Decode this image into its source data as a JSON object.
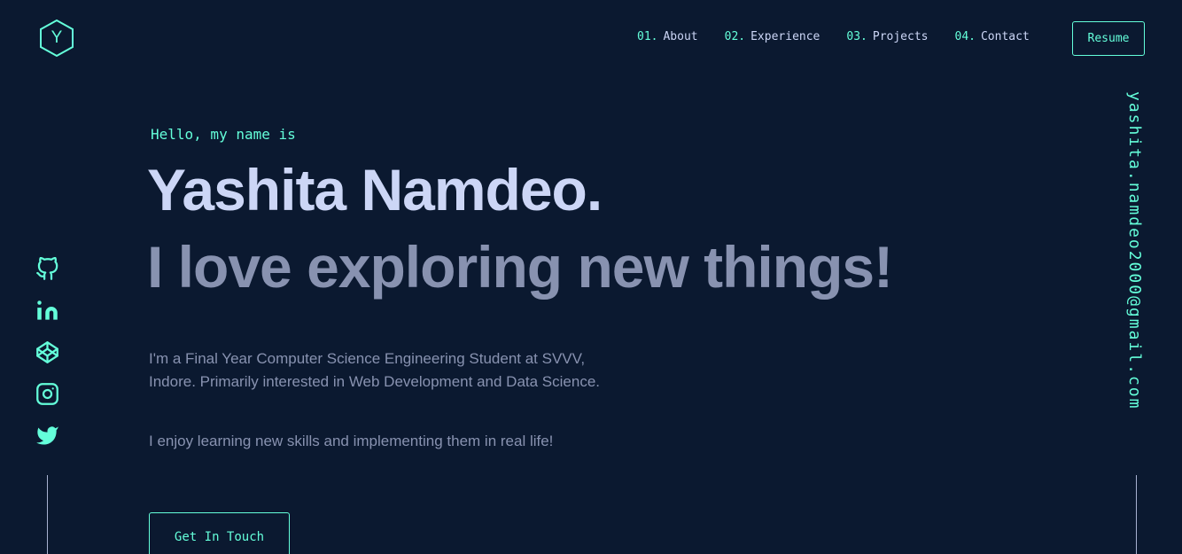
{
  "header": {
    "logo_letter": "Y",
    "nav": [
      {
        "num": "01.",
        "label": "About"
      },
      {
        "num": "02.",
        "label": "Experience"
      },
      {
        "num": "03.",
        "label": "Projects"
      },
      {
        "num": "04.",
        "label": "Contact"
      }
    ],
    "resume_label": "Resume"
  },
  "socials": [
    {
      "icon": "github-icon"
    },
    {
      "icon": "linkedin-icon"
    },
    {
      "icon": "codepen-icon"
    },
    {
      "icon": "instagram-icon"
    },
    {
      "icon": "twitter-icon"
    }
  ],
  "email": "yashita.namdeo2000@gmail.com",
  "hero": {
    "greeting": "Hello, my name is",
    "name": "Yashita Namdeo.",
    "tagline": "I love exploring new things!",
    "paragraph1": "I'm a Final Year Computer Science Engineering Student at SVVV, Indore. Primarily interested in Web Development and Data Science.",
    "paragraph2": "I enjoy learning new skills and implementing them in real life!",
    "cta_label": "Get In Touch"
  },
  "colors": {
    "background": "#0b1930",
    "accent": "#64ffda",
    "heading": "#ccd6f6",
    "text": "#8892b0"
  }
}
